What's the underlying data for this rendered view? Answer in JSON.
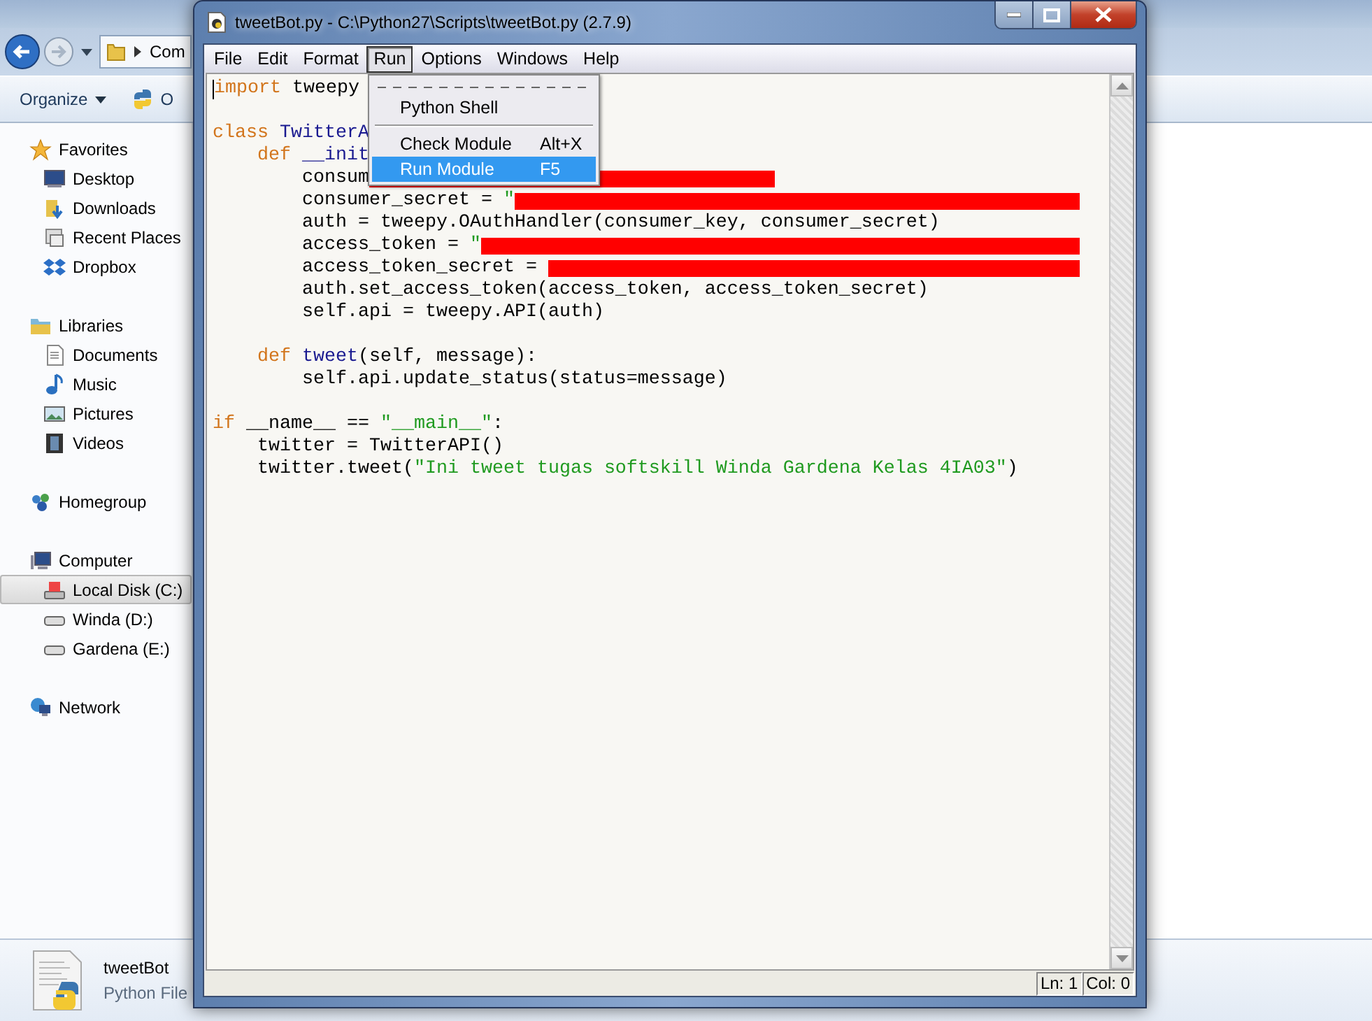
{
  "explorer": {
    "address": {
      "crumb": "Com"
    },
    "toolbar": {
      "organize": "Organize",
      "partial_button": "O"
    },
    "sidebar": [
      {
        "label": "Favorites",
        "selected": false,
        "children": [
          {
            "label": "Desktop",
            "selected": false
          },
          {
            "label": "Downloads",
            "selected": false
          },
          {
            "label": "Recent Places",
            "selected": false
          },
          {
            "label": "Dropbox",
            "selected": false
          }
        ]
      },
      {
        "label": "Libraries",
        "selected": false,
        "children": [
          {
            "label": "Documents",
            "selected": false
          },
          {
            "label": "Music",
            "selected": false
          },
          {
            "label": "Pictures",
            "selected": false
          },
          {
            "label": "Videos",
            "selected": false
          }
        ]
      },
      {
        "label": "Homegroup",
        "selected": false
      },
      {
        "label": "Computer",
        "selected": false,
        "children": [
          {
            "label": "Local Disk (C:)",
            "selected": true
          },
          {
            "label": "Winda (D:)",
            "selected": false
          },
          {
            "label": "Gardena (E:)",
            "selected": false
          }
        ]
      },
      {
        "label": "Network",
        "selected": false
      }
    ],
    "details": {
      "name": "tweetBot",
      "type": "Python File"
    }
  },
  "editor": {
    "window": {
      "title": "tweetBot.py - C:\\Python27\\Scripts\\tweetBot.py (2.7.9)"
    },
    "menus": [
      {
        "label": "File",
        "selected": false
      },
      {
        "label": "Edit",
        "selected": false
      },
      {
        "label": "Format",
        "selected": false
      },
      {
        "label": "Run",
        "selected": true
      },
      {
        "label": "Options",
        "selected": false
      },
      {
        "label": "Windows",
        "selected": false
      },
      {
        "label": "Help",
        "selected": false
      }
    ],
    "dropdown": [
      {
        "kind": "tearoff"
      },
      {
        "kind": "item",
        "label": "Python Shell",
        "selected": false
      },
      {
        "kind": "separator"
      },
      {
        "kind": "item",
        "label": "Check Module",
        "shortcut": "Alt+X",
        "selected": false
      },
      {
        "kind": "item",
        "label": "Run Module",
        "shortcut": "F5",
        "selected": true
      }
    ],
    "code": [
      {
        "kind": "code",
        "segments": [
          {
            "kind": "keyword",
            "text": "import"
          },
          {
            "kind": "plain",
            "text": " tweepy"
          }
        ]
      },
      {
        "kind": "blank"
      },
      {
        "kind": "code",
        "segments": [
          {
            "kind": "keyword",
            "text": "class"
          },
          {
            "kind": "name",
            "text": " TwitterA"
          }
        ]
      },
      {
        "kind": "code",
        "segments": [
          {
            "kind": "keyword",
            "text": "    def"
          },
          {
            "kind": "name",
            "text": " __init"
          }
        ]
      },
      {
        "kind": "code",
        "segments": [
          {
            "kind": "plain",
            "text": "        consum"
          },
          {
            "kind": "redaction-short"
          }
        ]
      },
      {
        "kind": "code",
        "segments": [
          {
            "kind": "plain",
            "text": "        consumer_secret = "
          },
          {
            "kind": "string",
            "text": "\""
          },
          {
            "kind": "redaction"
          }
        ]
      },
      {
        "kind": "code",
        "segments": [
          {
            "kind": "plain",
            "text": "        auth = tweepy.OAuthHandler(consumer_key, consumer_secret)"
          }
        ]
      },
      {
        "kind": "code",
        "segments": [
          {
            "kind": "plain",
            "text": "        access_token = "
          },
          {
            "kind": "string",
            "text": "\""
          },
          {
            "kind": "redaction"
          }
        ]
      },
      {
        "kind": "code",
        "segments": [
          {
            "kind": "plain",
            "text": "        access_token_secret = "
          },
          {
            "kind": "redaction"
          }
        ]
      },
      {
        "kind": "code",
        "segments": [
          {
            "kind": "plain",
            "text": "        auth.set_access_token(access_token, access_token_secret)"
          }
        ]
      },
      {
        "kind": "code",
        "segments": [
          {
            "kind": "plain",
            "text": "        self.api = tweepy.API(auth)"
          }
        ]
      },
      {
        "kind": "blank"
      },
      {
        "kind": "code",
        "segments": [
          {
            "kind": "keyword",
            "text": "    def"
          },
          {
            "kind": "name",
            "text": " tweet"
          },
          {
            "kind": "plain",
            "text": "(self, message):"
          }
        ]
      },
      {
        "kind": "code",
        "segments": [
          {
            "kind": "plain",
            "text": "        self.api.update_status(status=message)"
          }
        ]
      },
      {
        "kind": "blank"
      },
      {
        "kind": "code",
        "segments": [
          {
            "kind": "keyword",
            "text": "if"
          },
          {
            "kind": "plain",
            "text": " __name__ == "
          },
          {
            "kind": "string",
            "text": "\"__main__\""
          },
          {
            "kind": "plain",
            "text": ":"
          }
        ]
      },
      {
        "kind": "code",
        "segments": [
          {
            "kind": "plain",
            "text": "    twitter = TwitterAPI()"
          }
        ]
      },
      {
        "kind": "code",
        "segments": [
          {
            "kind": "plain",
            "text": "    twitter.tweet("
          },
          {
            "kind": "string",
            "text": "\"Ini tweet tugas softskill Winda Gardena Kelas 4IA03\""
          },
          {
            "kind": "plain",
            "text": ")"
          }
        ]
      }
    ],
    "status": {
      "line": "Ln: 1",
      "column": "Col: 0"
    }
  }
}
